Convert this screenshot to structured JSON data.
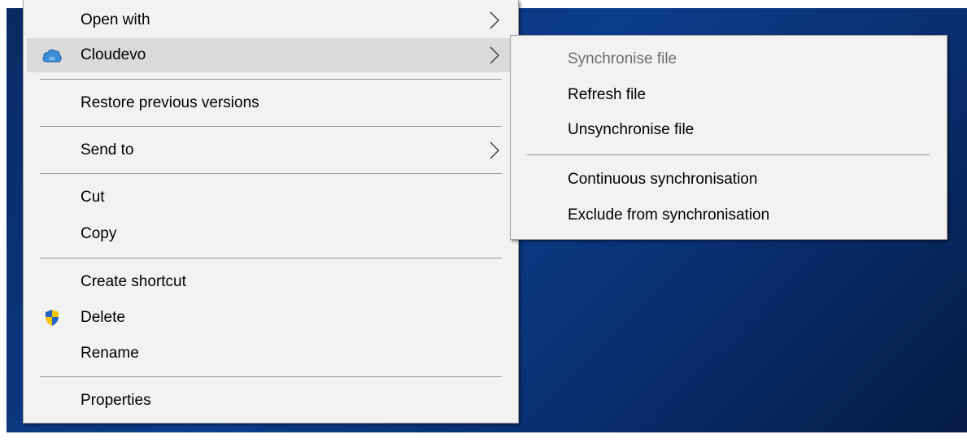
{
  "context_menu": {
    "items": [
      {
        "label": "Open with"
      },
      {
        "label": "Cloudevo"
      },
      {
        "label": "Restore previous versions"
      },
      {
        "label": "Send to"
      },
      {
        "label": "Cut"
      },
      {
        "label": "Copy"
      },
      {
        "label": "Create shortcut"
      },
      {
        "label": "Delete"
      },
      {
        "label": "Rename"
      },
      {
        "label": "Properties"
      }
    ]
  },
  "submenu": {
    "items": [
      {
        "label": "Synchronise file",
        "disabled": true
      },
      {
        "label": "Refresh file"
      },
      {
        "label": "Unsynchronise file"
      },
      {
        "label": "Continuous synchronisation"
      },
      {
        "label": "Exclude from synchronisation"
      }
    ]
  },
  "colors": {
    "menu_background": "#f2f2f2",
    "highlight": "#dadada",
    "desktop_background": "#0b3d8c",
    "cloud_icon": "#3a8fd6",
    "shield_blue": "#2463c6",
    "shield_yellow": "#f6c400"
  },
  "icons": {
    "cloudevo": "cloud-icon",
    "delete": "shield-icon",
    "submenu_arrow": "chevron-right-icon"
  }
}
